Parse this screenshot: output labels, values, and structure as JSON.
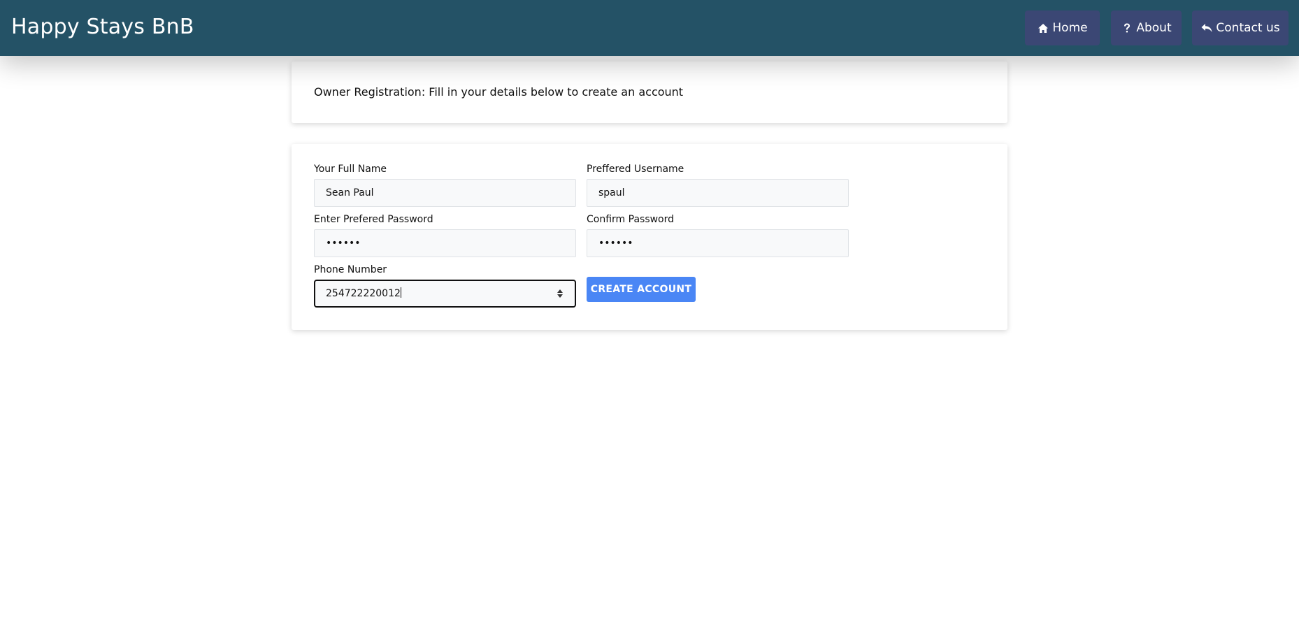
{
  "app": {
    "brand": "Happy Stays BnB"
  },
  "nav": {
    "items": [
      {
        "label": "Home",
        "icon": "home-icon"
      },
      {
        "label": "About",
        "icon": "question-icon"
      },
      {
        "label": "Contact us",
        "icon": "reply-icon"
      }
    ]
  },
  "header": {
    "text": "Owner Registration: Fill in your details below to create an account"
  },
  "form": {
    "full_name": {
      "label": "Your Full Name",
      "value": "Sean Paul"
    },
    "username": {
      "label": "Preffered Username",
      "value": "spaul"
    },
    "password": {
      "label": "Enter Prefered Password",
      "value": "••••••"
    },
    "confirm_password": {
      "label": "Confirm Password",
      "value": "••••••"
    },
    "phone": {
      "label": "Phone Number",
      "value": "254722220012"
    },
    "submit_label": "CREATE ACCOUNT"
  },
  "colors": {
    "navbar": "#245266",
    "nav_button": "#3b4774",
    "primary_button": "#4a86f5"
  }
}
